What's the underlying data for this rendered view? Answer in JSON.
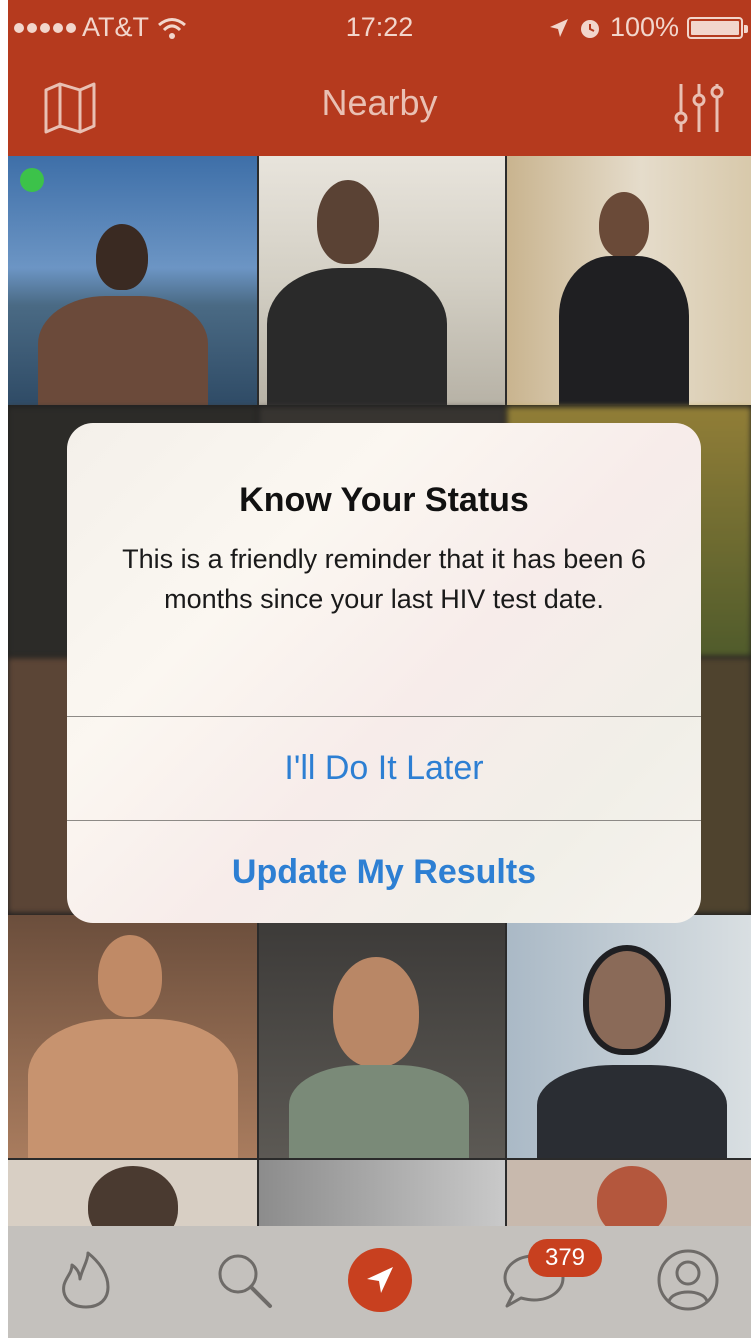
{
  "status_bar": {
    "carrier": "AT&T",
    "time": "17:22",
    "battery": "100%"
  },
  "nav": {
    "title": "Nearby",
    "left_icon": "map-icon",
    "right_icon": "filter-sliders-icon"
  },
  "alert": {
    "title": "Know Your Status",
    "message": "This is a friendly reminder that it has been 6 months since your last HIV test date.",
    "buttons": [
      {
        "label": "I'll Do It Later"
      },
      {
        "label": "Update My Results"
      }
    ]
  },
  "tab_bar": {
    "tabs": [
      {
        "icon": "flame-icon"
      },
      {
        "icon": "search-icon"
      },
      {
        "icon": "location-arrow-icon",
        "active": true
      },
      {
        "icon": "chat-bubble-icon"
      },
      {
        "icon": "profile-icon"
      }
    ],
    "chat_badge": "379"
  },
  "colors": {
    "brand": "#b53a1e",
    "accent": "#c8401f",
    "alert_button": "#2d7fd3",
    "online": "#3cc24a"
  }
}
